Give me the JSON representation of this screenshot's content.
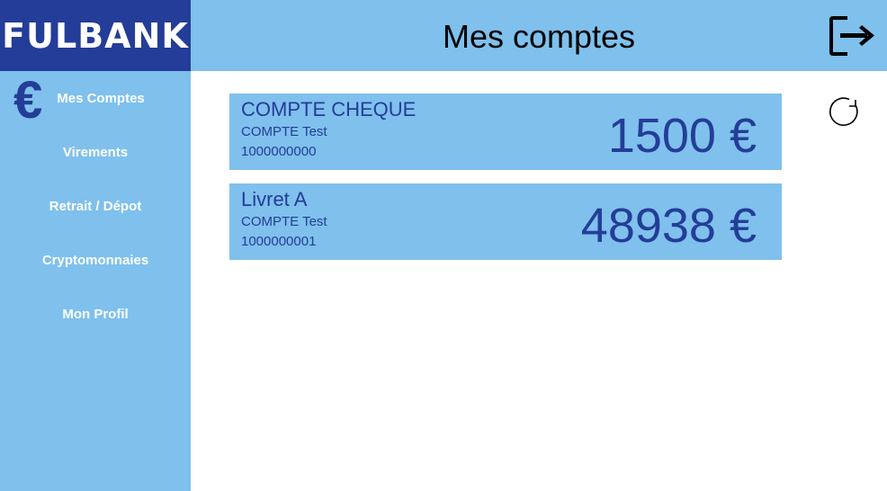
{
  "app": {
    "logo_text": "FULBANK"
  },
  "header": {
    "title": "Mes comptes",
    "logout_icon": "logout-icon"
  },
  "sidebar": {
    "brand_icon_glyph": "€",
    "items": [
      {
        "label": "Mes Comptes",
        "active": true
      },
      {
        "label": "Virements"
      },
      {
        "label": "Retrait / Dépot"
      },
      {
        "label": "Cryptomonnaies"
      },
      {
        "label": "Mon Profil"
      }
    ]
  },
  "main": {
    "refresh_icon": "refresh-icon",
    "accounts": [
      {
        "name": "COMPTE CHEQUE",
        "owner": "COMPTE Test",
        "number": "1000000000",
        "balance": "1500 €"
      },
      {
        "name": "Livret A",
        "owner": "COMPTE Test",
        "number": "1000000001",
        "balance": "48938 €"
      }
    ]
  },
  "colors": {
    "brand_dark": "#243d98",
    "brand_light": "#7fc0ec",
    "text_on_light": "#243d98",
    "nav_text": "#ffffff"
  }
}
